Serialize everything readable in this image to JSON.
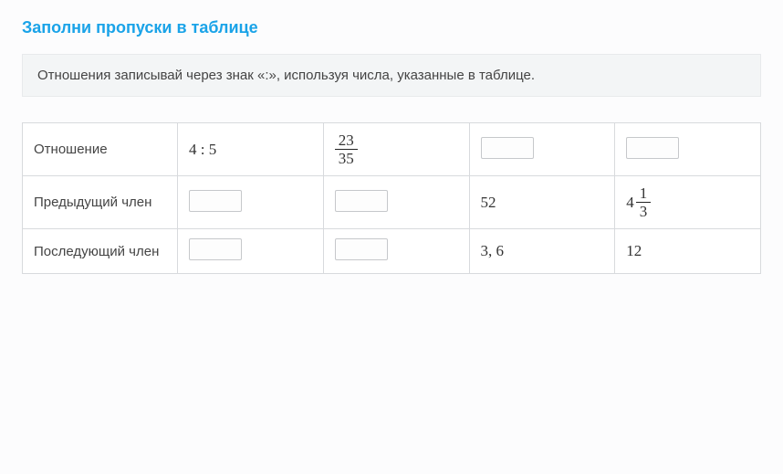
{
  "title": "Заполни пропуски в таблице",
  "hint": "Отношения записывай через знак «:», используя числа, указанные в таблице.",
  "rows": {
    "ratio": {
      "label": "Отношение"
    },
    "antecedent": {
      "label": "Предыдущий член"
    },
    "consequent": {
      "label": "Последующий член"
    }
  },
  "col1": {
    "ratio": "4 : 5"
  },
  "col2": {
    "ratio_frac": {
      "num": "23",
      "den": "35"
    }
  },
  "col3": {
    "antecedent": "52",
    "consequent": "3, 6"
  },
  "col4": {
    "antecedent_mixed": {
      "whole": "4",
      "num": "1",
      "den": "3"
    },
    "consequent": "12"
  }
}
